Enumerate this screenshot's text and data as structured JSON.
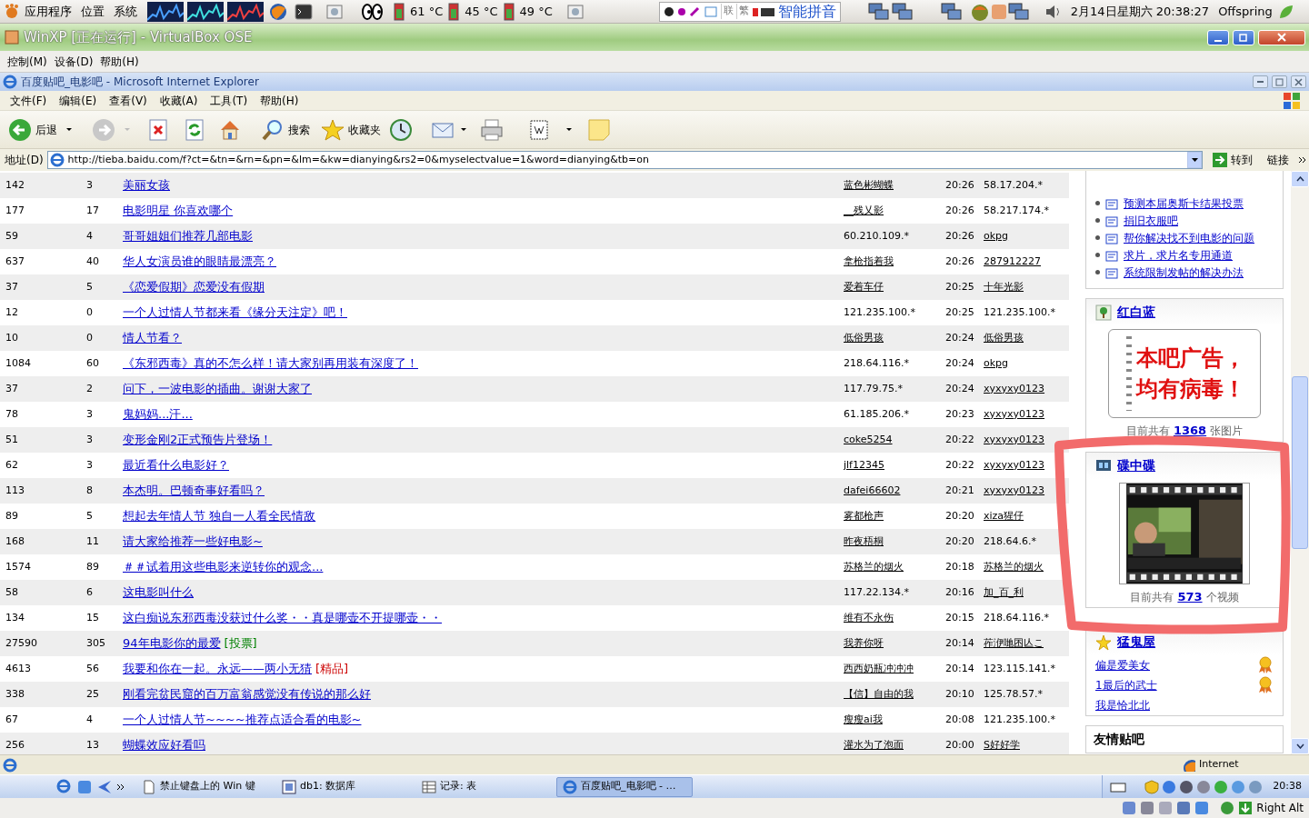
{
  "top_panel": {
    "menus": [
      "应用程序",
      "位置",
      "系统"
    ],
    "temps": [
      "61 °C",
      "45 °C",
      "49 °C"
    ],
    "ime": {
      "keys": [
        "联",
        "繁"
      ],
      "name": "智能拼音"
    },
    "datetime": "2月14日星期六 20:38:27",
    "user": "Offspring"
  },
  "vbox": {
    "title": "WinXP [正在运行] - VirtualBox OSE",
    "menu": [
      "控制(M)",
      "设备(D)",
      "帮助(H)"
    ],
    "status": "Right Alt"
  },
  "ie": {
    "title": "百度贴吧_电影吧 - Microsoft Internet Explorer",
    "menu": [
      "文件(F)",
      "编辑(E)",
      "查看(V)",
      "收藏(A)",
      "工具(T)",
      "帮助(H)"
    ],
    "back": "后退",
    "search": "搜索",
    "favorites": "收藏夹",
    "address_label": "地址(D)",
    "url": "http://tieba.baidu.com/f?ct=&tn=&rn=&pn=&lm=&kw=dianying&rs2=0&myselectvalue=1&word=dianying&tb=on",
    "go": "转到",
    "links": "链接",
    "status": "Internet"
  },
  "threads": [
    {
      "clicks": "142",
      "replies": "3",
      "title": "美丽女孩",
      "author": "蓝色彬蝴蝶",
      "author_link": true,
      "time": "20:26",
      "last": "58.17.204.*",
      "last_link": false
    },
    {
      "clicks": "177",
      "replies": "17",
      "title": "电影明星 你喜欢哪个",
      "author": "__残乂影",
      "author_link": true,
      "time": "20:26",
      "last": "58.217.174.*",
      "last_link": false
    },
    {
      "clicks": "59",
      "replies": "4",
      "title": "哥哥姐姐们推荐几部电影",
      "author": "60.210.109.*",
      "author_link": false,
      "time": "20:26",
      "last": "okpg",
      "last_link": true
    },
    {
      "clicks": "637",
      "replies": "40",
      "title": "华人女演员谁的眼睛最漂亮？",
      "author": "拿枪指着我",
      "author_link": true,
      "time": "20:26",
      "last": "287912227",
      "last_link": true
    },
    {
      "clicks": "37",
      "replies": "5",
      "title": "《恋爱假期》恋爱没有假期",
      "author": "爱着车仔",
      "author_link": true,
      "time": "20:25",
      "last": "十年光影",
      "last_link": true
    },
    {
      "clicks": "12",
      "replies": "0",
      "title": "一个人过情人节都来看《缘分天注定》吧！",
      "author": "121.235.100.*",
      "author_link": false,
      "time": "20:25",
      "last": "121.235.100.*",
      "last_link": false
    },
    {
      "clicks": "10",
      "replies": "0",
      "title": "情人节看？",
      "author": "低俗男孩",
      "author_link": true,
      "time": "20:24",
      "last": "低俗男孩",
      "last_link": true
    },
    {
      "clicks": "1084",
      "replies": "60",
      "title": "《东邪西毒》真的不怎么样！请大家别再用装有深度了！",
      "author": "218.64.116.*",
      "author_link": false,
      "time": "20:24",
      "last": "okpg",
      "last_link": true
    },
    {
      "clicks": "37",
      "replies": "2",
      "title": "问下，一波电影的插曲。谢谢大家了",
      "author": "117.79.75.*",
      "author_link": false,
      "time": "20:24",
      "last": "xyxyxy0123",
      "last_link": true
    },
    {
      "clicks": "78",
      "replies": "3",
      "title": "鬼妈妈...汗...",
      "author": "61.185.206.*",
      "author_link": false,
      "time": "20:23",
      "last": "xyxyxy0123",
      "last_link": true
    },
    {
      "clicks": "51",
      "replies": "3",
      "title": "变形金刚2正式预告片登场！",
      "author": "coke5254",
      "author_link": true,
      "time": "20:22",
      "last": "xyxyxy0123",
      "last_link": true
    },
    {
      "clicks": "62",
      "replies": "3",
      "title": "最近看什么电影好？",
      "author": "jlf12345",
      "author_link": true,
      "time": "20:22",
      "last": "xyxyxy0123",
      "last_link": true
    },
    {
      "clicks": "113",
      "replies": "8",
      "title": "本杰明。巴顿奇事好看吗？",
      "author": "dafei66602",
      "author_link": true,
      "time": "20:21",
      "last": "xyxyxy0123",
      "last_link": true
    },
    {
      "clicks": "89",
      "replies": "5",
      "title": "想起去年情人节 独自一人看全民情敌",
      "author": "雾都枪声",
      "author_link": true,
      "time": "20:20",
      "last": "xiza猩仔",
      "last_link": true
    },
    {
      "clicks": "168",
      "replies": "11",
      "title": "请大家给推荐一些好电影~",
      "author": "昨夜梧桐",
      "author_link": true,
      "time": "20:20",
      "last": "218.64.6.*",
      "last_link": false
    },
    {
      "clicks": "1574",
      "replies": "89",
      "title": "＃＃试着用这些电影来逆转你的观念...",
      "author": "苏格兰的烟火",
      "author_link": true,
      "time": "20:18",
      "last": "苏格兰的烟火",
      "last_link": true
    },
    {
      "clicks": "58",
      "replies": "6",
      "title": "这电影叫什么",
      "author": "117.22.134.*",
      "author_link": false,
      "time": "20:16",
      "last": "加_百_利",
      "last_link": true
    },
    {
      "clicks": "134",
      "replies": "15",
      "title": "这白痴说东邪西毒没获过什么奖・・真是哪壶不开提哪壶・・",
      "author": "维有不永伤",
      "author_link": true,
      "time": "20:15",
      "last": "218.64.116.*",
      "last_link": false
    },
    {
      "clicks": "27590",
      "replies": "305",
      "title": "94年电影你的最爱",
      "tag": {
        "text": "[投票]",
        "color": "#008000"
      },
      "author": "我养你呀",
      "author_link": true,
      "time": "20:14",
      "last": "莋洢哋囨亾こ",
      "last_link": true
    },
    {
      "clicks": "4613",
      "replies": "56",
      "title": "我要和你在一起。永远——两小无猜",
      "tag": {
        "text": "[精品]",
        "color": "#cc0000"
      },
      "author": "西西奶瓶冲冲冲",
      "author_link": true,
      "time": "20:14",
      "last": "123.115.141.*",
      "last_link": false
    },
    {
      "clicks": "338",
      "replies": "25",
      "title": "刚看完贫民窟的百万富翁感觉没有传说的那么好",
      "author": "【信】自由的我",
      "author_link": true,
      "time": "20:10",
      "last": "125.78.57.*",
      "last_link": false
    },
    {
      "clicks": "67",
      "replies": "4",
      "title": "一个人过情人节~~~~推荐点适合看的电影~",
      "author": "瘦瘦ai我",
      "author_link": true,
      "time": "20:08",
      "last": "121.235.100.*",
      "last_link": false
    },
    {
      "clicks": "256",
      "replies": "13",
      "title": "蝴蝶效应好看吗",
      "author": "灌水为了泡面",
      "author_link": true,
      "time": "20:00",
      "last": "S好好学",
      "last_link": true
    }
  ],
  "sidebar": {
    "top_links": [
      "预测本届奥斯卡结果投票",
      "捐旧衣服吧",
      "帮你解决找不到电影的问题",
      "求片，求片名专用通道",
      "系统限制发帖的解决办法"
    ],
    "photo_box": {
      "title": "红白蓝",
      "note_lines": [
        "本吧广告，",
        "均有病毒！"
      ],
      "count_prefix": "目前共有",
      "count": "1368",
      "count_suffix": "张图片"
    },
    "video_box": {
      "title": "碟中碟",
      "count_prefix": "目前共有",
      "count": "573",
      "count_suffix": "个视频"
    },
    "ghost_box": {
      "title": "猛鬼屋",
      "members": [
        {
          "name": "偏是爱美女",
          "medal": true
        },
        {
          "name": "1最后的武士",
          "medal": true
        },
        {
          "name": "我是恰北北",
          "medal": false
        }
      ]
    },
    "friends_box": {
      "title": "友情贴吧"
    }
  },
  "taskbar": {
    "items": [
      {
        "label": "禁止键盘上的 Win 键",
        "selected": false
      },
      {
        "label": "db1: 数据库",
        "selected": false
      },
      {
        "label": "记录: 表",
        "selected": false
      },
      {
        "label": "百度贴吧_电影吧 - …",
        "selected": true
      }
    ],
    "clock": "20:38"
  }
}
